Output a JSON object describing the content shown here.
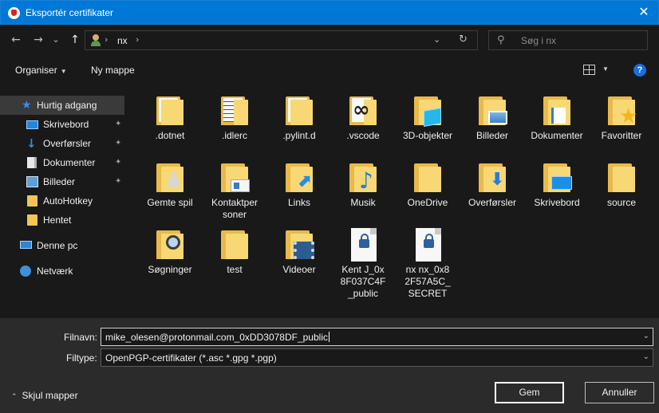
{
  "window": {
    "title": "Eksportér certifikater",
    "close_glyph": "✕"
  },
  "nav": {
    "back_glyph": "←",
    "forward_glyph": "→",
    "recent_glyph": "⌄",
    "up_glyph": "↑",
    "path": [
      "nx"
    ],
    "separator_glyph": "›",
    "dropdown_glyph": "⌄",
    "refresh_glyph": "↻",
    "search_placeholder": "Søg i nx",
    "search_glyph": "⚲"
  },
  "toolbar": {
    "organize_label": "Organiser",
    "new_folder_label": "Ny mappe",
    "caret_glyph": "▼",
    "help_glyph": "?"
  },
  "sidebar": {
    "quick_access": "Hurtig adgang",
    "items": [
      {
        "label": "Skrivebord",
        "icon": "desktop-icon",
        "pinned": true
      },
      {
        "label": "Overførsler",
        "icon": "downloads-icon",
        "pinned": true
      },
      {
        "label": "Dokumenter",
        "icon": "documents-icon",
        "pinned": true
      },
      {
        "label": "Billeder",
        "icon": "pictures-icon",
        "pinned": true
      },
      {
        "label": "AutoHotkey",
        "icon": "folder-icon",
        "pinned": false
      },
      {
        "label": "Hentet",
        "icon": "folder-icon",
        "pinned": false
      }
    ],
    "this_pc": "Denne pc",
    "network": "Netværk",
    "pin_glyph": "✦",
    "star_glyph": "★",
    "download_glyph": "↓"
  },
  "files": [
    {
      "label": ".dotnet",
      "type": "folder-doc"
    },
    {
      "label": ".idlerc",
      "type": "folder-lines"
    },
    {
      "label": ".pylint.d",
      "type": "folder-doc"
    },
    {
      "label": ".vscode",
      "type": "folder-vscode"
    },
    {
      "label": "3D-objekter",
      "type": "folder-3d"
    },
    {
      "label": "Billeder",
      "type": "folder-pictures"
    },
    {
      "label": "Dokumenter",
      "type": "folder-documents"
    },
    {
      "label": "Favoritter",
      "type": "folder-favorites"
    },
    {
      "label": "Gemte spil",
      "type": "folder-games"
    },
    {
      "label": "Kontaktpersoner",
      "type": "folder-contacts"
    },
    {
      "label": "Links",
      "type": "folder-links"
    },
    {
      "label": "Musik",
      "type": "folder-music"
    },
    {
      "label": "OneDrive",
      "type": "folder-plain"
    },
    {
      "label": "Overførsler",
      "type": "folder-downloads"
    },
    {
      "label": "Skrivebord",
      "type": "folder-desktop"
    },
    {
      "label": "source",
      "type": "folder-plain"
    },
    {
      "label": "Søgninger",
      "type": "folder-searches"
    },
    {
      "label": "test",
      "type": "folder-plain"
    },
    {
      "label": "Videoer",
      "type": "folder-videos"
    },
    {
      "label": "Kent J_0x8F037C4F_public",
      "type": "cert-file"
    },
    {
      "label": "nx nx_0x82F57A5C_SECRET",
      "type": "cert-file"
    }
  ],
  "glyphs": {
    "star": "★",
    "chess": "♟",
    "arrow": "⬈",
    "note": "♪",
    "download": "⬇",
    "vscode": "∞"
  },
  "filename": {
    "label": "Filnavn:",
    "value": "mike_olesen@protonmail.com_0xDD3078DF_public"
  },
  "filetype": {
    "label": "Filtype:",
    "value": "OpenPGP-certifikater (*.asc *.gpg *.pgp)"
  },
  "footer": {
    "hide_folders": "Skjul mapper",
    "chevron_glyph": "⌃",
    "save_label": "Gem",
    "cancel_label": "Annuller"
  }
}
